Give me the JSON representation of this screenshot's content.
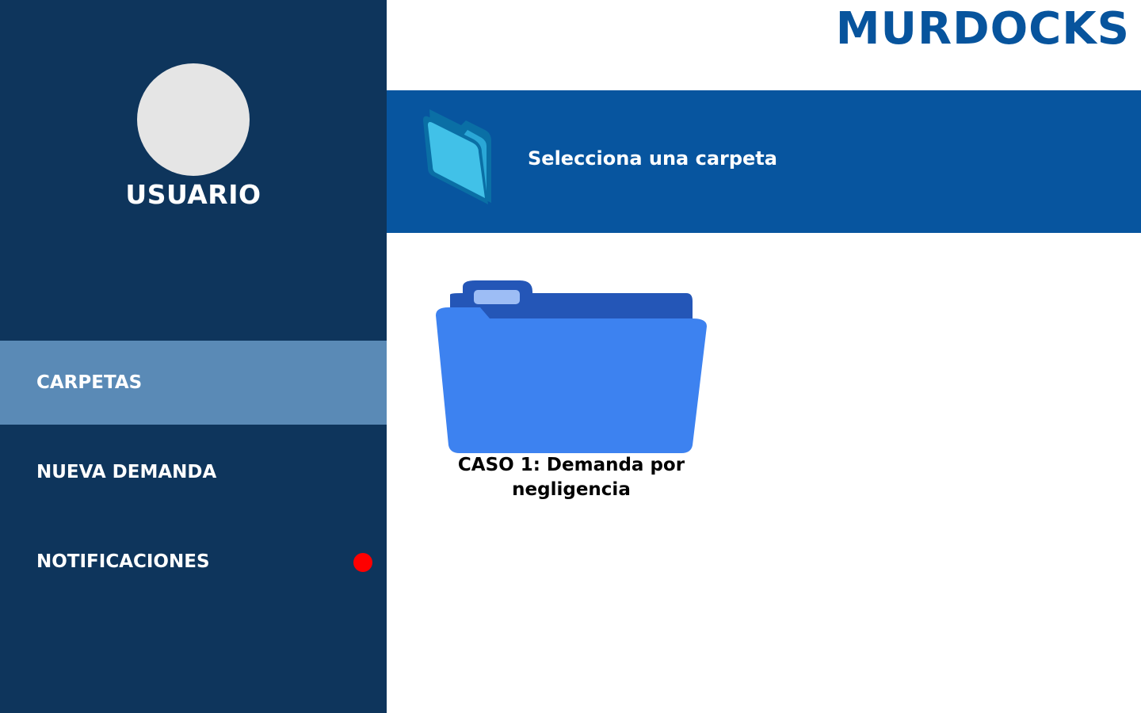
{
  "app": {
    "brand": "MURDOCKS"
  },
  "user": {
    "name": "USUARIO"
  },
  "sidebar": {
    "items": [
      {
        "label": "CARPETAS",
        "active": true
      },
      {
        "label": "NUEVA DEMANDA",
        "active": false
      },
      {
        "label": "NOTIFICACIONES",
        "active": false,
        "badge": "red-dot"
      }
    ]
  },
  "banner": {
    "text": "Selecciona una carpeta",
    "icon": "open-folder-icon"
  },
  "folders": [
    {
      "label": "CASO 1: Demanda por negligencia",
      "icon": "folder-icon"
    }
  ],
  "colors": {
    "sidebar": "#0e355c",
    "active": "#5a8ab6",
    "banner": "#07559f",
    "brand": "#07549d",
    "folder": "#3d82f0",
    "badge": "#ff0000"
  }
}
